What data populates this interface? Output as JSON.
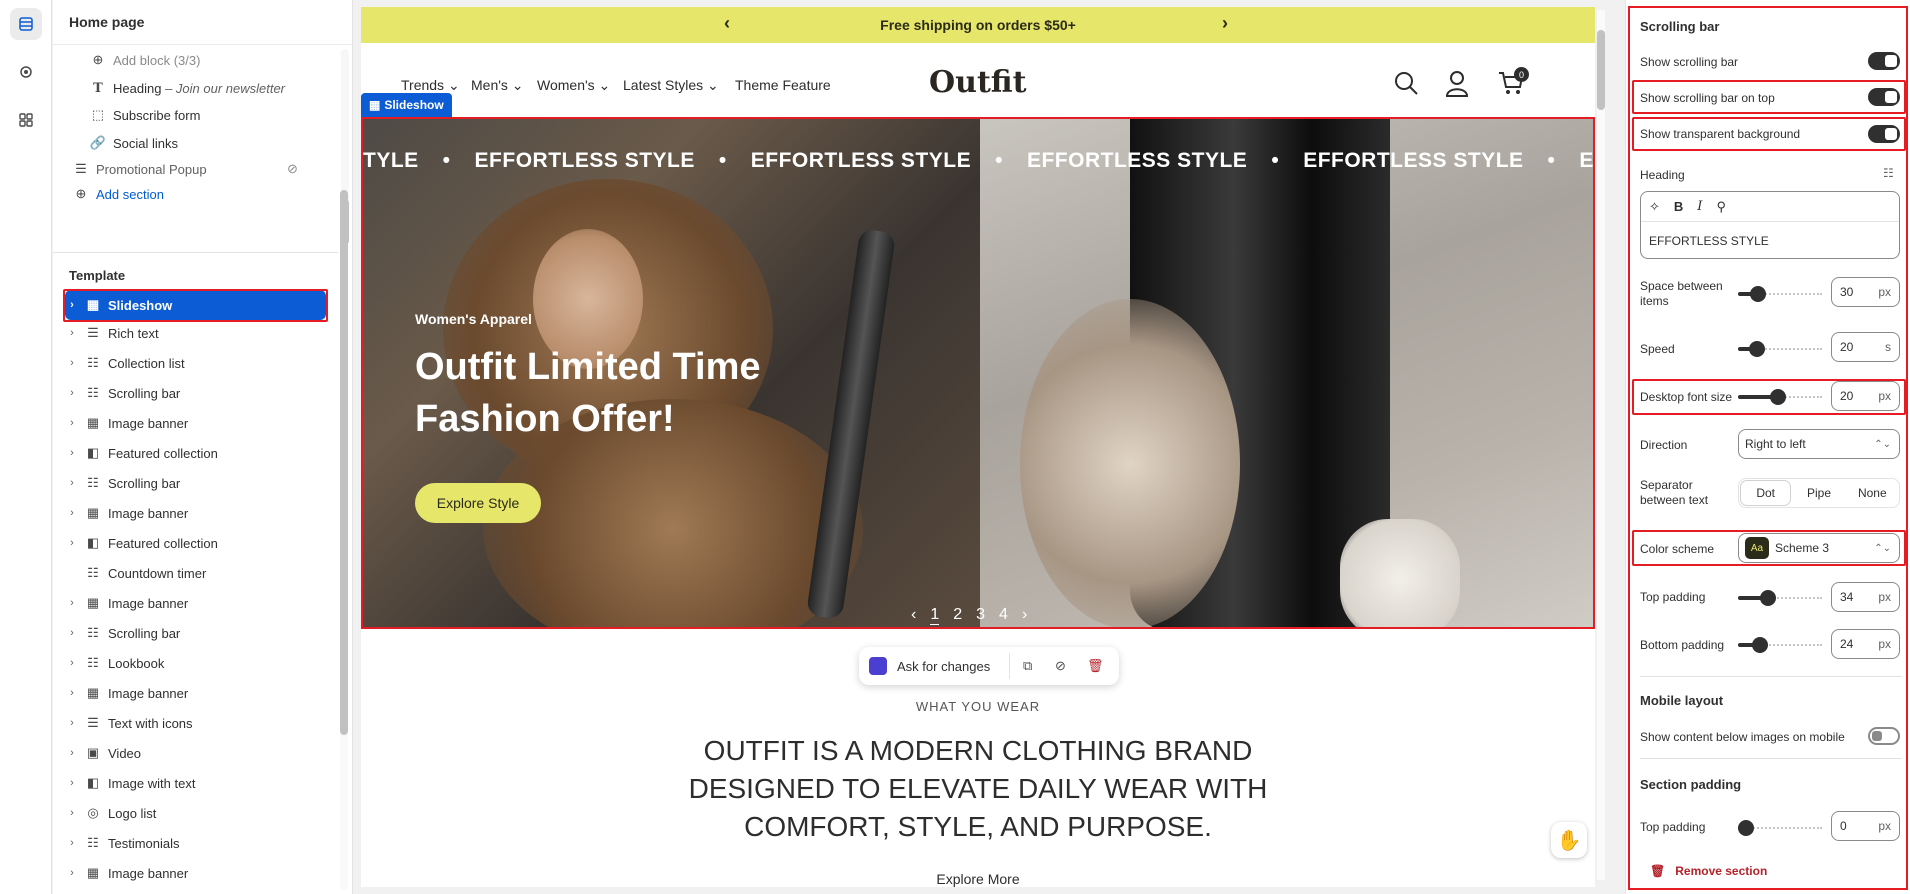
{
  "left_panel": {
    "title": "Home page",
    "header_items": [
      {
        "label": "Add block (3/3)"
      },
      {
        "label": "Heading",
        "sub": "– Join our newsletter"
      },
      {
        "label": "Subscribe form"
      },
      {
        "label": "Social links"
      },
      {
        "label": "Promotional Popup"
      },
      {
        "label": "Add section"
      }
    ],
    "template_label": "Template",
    "sections": [
      "Slideshow",
      "Rich text",
      "Collection list",
      "Scrolling bar",
      "Image banner",
      "Featured collection",
      "Scrolling bar",
      "Image banner",
      "Featured collection",
      "Countdown timer",
      "Image banner",
      "Scrolling bar",
      "Lookbook",
      "Image banner",
      "Text with icons",
      "Video",
      "Image with text",
      "Logo list",
      "Testimonials",
      "Image banner"
    ]
  },
  "preview": {
    "announcement": "Free shipping on orders $50+",
    "nav_links": [
      "Trends",
      "Men's",
      "Women's",
      "Latest Styles",
      "Theme Feature"
    ],
    "logo": "Outfit",
    "cart_count": "0",
    "slideshow_tag": "Slideshow",
    "marquee_text": "EFFORTLESS STYLE",
    "marquee_partial_start": "TYLE",
    "marquee_partial_end": "EFFORTL",
    "hero_tag": "Women's Apparel",
    "hero_title": "Outfit Limited Time Fashion Offer!",
    "hero_button": "Explore Style",
    "pager": [
      "1",
      "2",
      "3",
      "4"
    ],
    "floatbar_label": "Ask for changes",
    "eyebrow": "WHAT YOU WEAR",
    "body_text": "OUTFIT IS A MODERN CLOTHING BRAND DESIGNED TO ELEVATE DAILY WEAR  WITH COMFORT, STYLE, AND PURPOSE.",
    "explore_more": "Explore More"
  },
  "settings": {
    "title": "Scrolling bar",
    "show_scrolling_bar": "Show scrolling bar",
    "show_on_top": "Show scrolling bar on top",
    "transparent_bg": "Show transparent background",
    "heading_label": "Heading",
    "heading_value": "EFFORTLESS STYLE",
    "space_between_label": "Space between items",
    "space_between_value": "30",
    "space_between_unit": "px",
    "speed_label": "Speed",
    "speed_value": "20",
    "speed_unit": "s",
    "font_size_label": "Desktop font size",
    "font_size_value": "20",
    "font_size_unit": "px",
    "direction_label": "Direction",
    "direction_value": "Right to left",
    "separator_label": "Separator between text",
    "separator_options": [
      "Dot",
      "Pipe",
      "None"
    ],
    "separator_selected": "Dot",
    "color_scheme_label": "Color scheme",
    "color_scheme_value": "Scheme 3",
    "color_scheme_swatch": "Aa",
    "top_padding_label": "Top padding",
    "top_padding_value": "34",
    "bottom_padding_label": "Bottom padding",
    "bottom_padding_value": "24",
    "padding_unit": "px",
    "mobile_layout_title": "Mobile layout",
    "mobile_content_below": "Show content below images on mobile",
    "section_padding_title": "Section padding",
    "section_top_padding_label": "Top padding",
    "section_top_padding_value": "0",
    "remove_section": "Remove section"
  },
  "colors": {
    "accent_blue": "#0b5cd5",
    "highlight_red": "#e51c23",
    "announcement_bg": "#e6e66a",
    "danger": "#b4232b"
  }
}
